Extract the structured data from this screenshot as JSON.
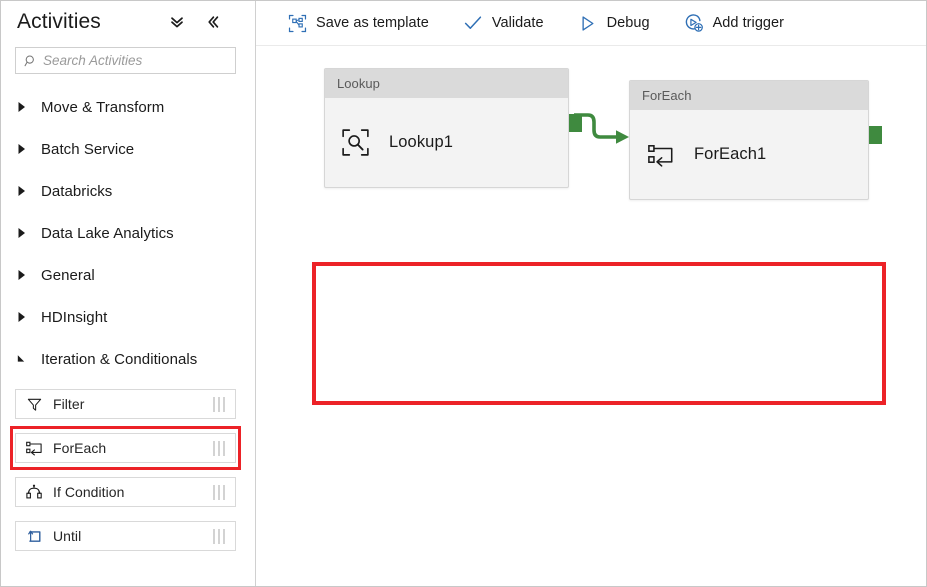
{
  "sidebar": {
    "title": "Activities",
    "header_icons": [
      {
        "name": "expand-collapse-all-icon",
        "glyph": "chevron-double-down"
      },
      {
        "name": "collapse-panel-icon",
        "glyph": "chevron-double-left"
      }
    ],
    "search": {
      "placeholder": "Search Activities",
      "value": "",
      "icon": "search-icon"
    },
    "categories": [
      {
        "label": "Move & Transform",
        "expanded": false
      },
      {
        "label": "Batch Service",
        "expanded": false
      },
      {
        "label": "Databricks",
        "expanded": false
      },
      {
        "label": "Data Lake Analytics",
        "expanded": false
      },
      {
        "label": "General",
        "expanded": false
      },
      {
        "label": "HDInsight",
        "expanded": false
      },
      {
        "label": "Iteration & Conditionals",
        "expanded": true
      }
    ],
    "activities": [
      {
        "label": "Filter",
        "icon": "filter-funnel-icon",
        "highlighted": false
      },
      {
        "label": "ForEach",
        "icon": "foreach-loop-icon",
        "highlighted": true
      },
      {
        "label": "If Condition",
        "icon": "if-condition-branch-icon",
        "highlighted": false
      },
      {
        "label": "Until",
        "icon": "until-loop-icon",
        "highlighted": false
      }
    ]
  },
  "toolbar": {
    "buttons": [
      {
        "label": "Save as template",
        "icon": "save-as-template-icon"
      },
      {
        "label": "Validate",
        "icon": "validate-check-icon"
      },
      {
        "label": "Debug",
        "icon": "debug-play-icon"
      },
      {
        "label": "Add trigger",
        "icon": "add-trigger-icon"
      }
    ]
  },
  "canvas": {
    "nodes": [
      {
        "type_label": "Lookup",
        "name": "Lookup1",
        "icon": "lookup-magnifier-icon"
      },
      {
        "type_label": "ForEach",
        "name": "ForEach1",
        "icon": "foreach-loop-icon"
      }
    ],
    "connection": {
      "from": "Lookup1",
      "to": "ForEach1",
      "color": "#3f8a3f"
    },
    "highlight_color": "#ec2227"
  },
  "colors": {
    "accent": "#2f6fb5",
    "highlight_red": "#ec2227",
    "connector_green": "#3f8a3f",
    "node_header": "#dadada",
    "node_body": "#f3f3f3"
  }
}
